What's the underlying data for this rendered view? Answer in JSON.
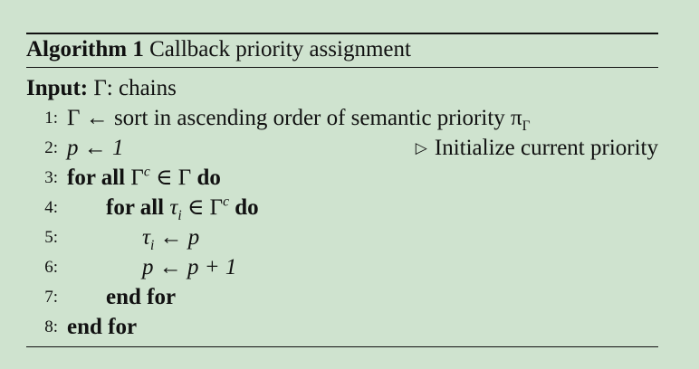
{
  "algorithm": {
    "label": "Algorithm 1",
    "title": "Callback priority assignment",
    "input_label": "Input:",
    "input_value": "Γ: chains",
    "lines": [
      {
        "num": "1:",
        "text": "Γ ← sort in ascending order of semantic priority π"
      },
      {
        "num": "2:",
        "text": "p ← 1",
        "comment": "Initialize current priority"
      },
      {
        "num": "3:",
        "kw_start": "for all",
        "expr": "Γc ∈ Γ",
        "kw_end": "do"
      },
      {
        "num": "4:",
        "kw_start": "for all",
        "expr": "τi ∈ Γc",
        "kw_end": "do"
      },
      {
        "num": "5:",
        "text": "τi ← p"
      },
      {
        "num": "6:",
        "text": "p ← p + 1"
      },
      {
        "num": "7:",
        "kw_start": "end for"
      },
      {
        "num": "8:",
        "kw_start": "end for"
      }
    ]
  }
}
